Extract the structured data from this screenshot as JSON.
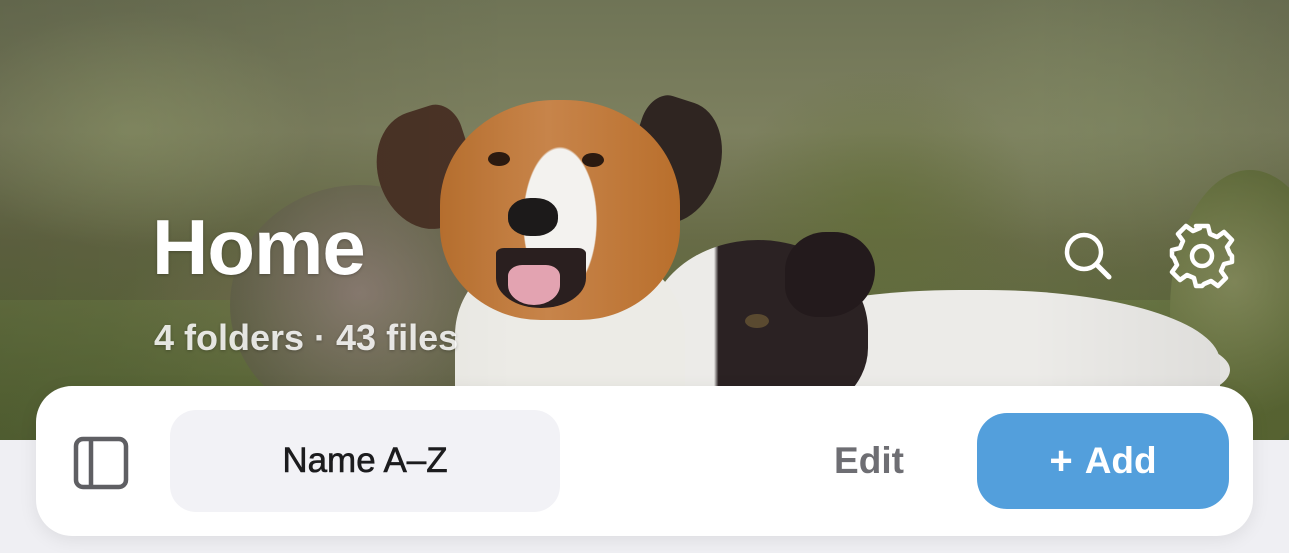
{
  "header": {
    "title": "Home",
    "summary": "4 folders · 43 files"
  },
  "actions": {
    "search_icon": "search-icon",
    "settings_icon": "gear-icon"
  },
  "toolbar": {
    "sidebar_icon": "sidebar-icon",
    "sort_label": "Name A–Z",
    "edit_label": "Edit",
    "add_icon": "+",
    "add_label": "Add"
  },
  "colors": {
    "accent": "#539fdc",
    "edit_text": "#6e6e73",
    "sort_pill_background": "#f2f2f6",
    "page_background": "#efeff3"
  }
}
